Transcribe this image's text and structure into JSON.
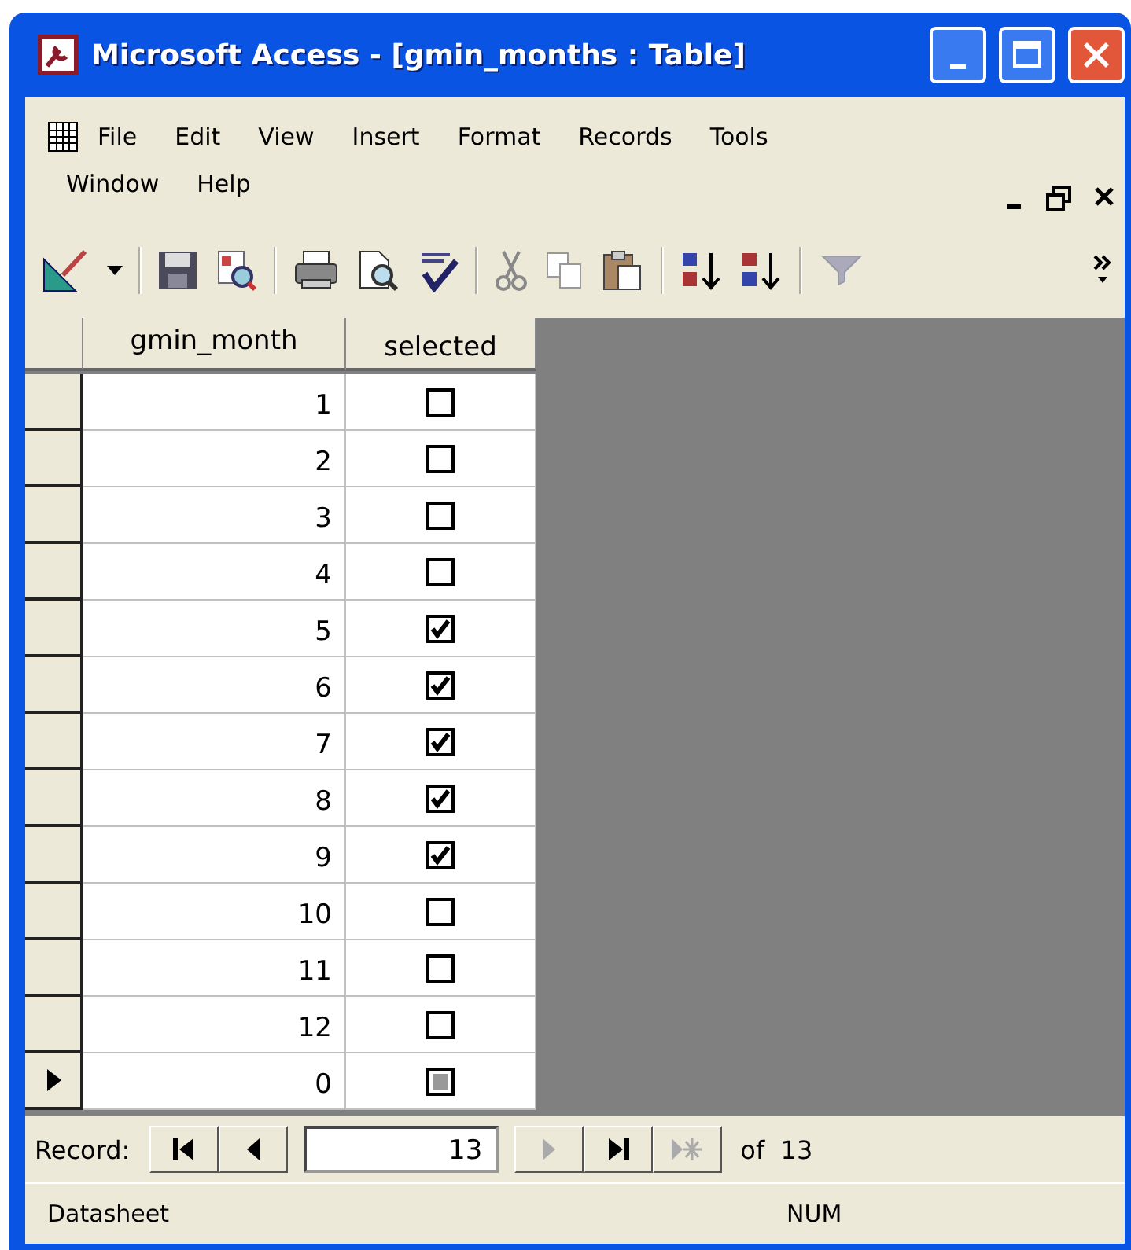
{
  "window": {
    "title": "Microsoft Access - [gmin_months : Table]"
  },
  "menu_bar": {
    "items": [
      {
        "label": "File"
      },
      {
        "label": "Edit"
      },
      {
        "label": "View"
      },
      {
        "label": "Insert"
      },
      {
        "label": "Format"
      },
      {
        "label": "Records"
      },
      {
        "label": "Tools"
      },
      {
        "label": "Window"
      },
      {
        "label": "Help"
      }
    ]
  },
  "datasheet": {
    "columns": [
      "gmin_month",
      "selected"
    ],
    "rows": [
      {
        "gmin_month": "1",
        "checked": false,
        "indeterminate": false,
        "current": false
      },
      {
        "gmin_month": "2",
        "checked": false,
        "indeterminate": false,
        "current": false
      },
      {
        "gmin_month": "3",
        "checked": false,
        "indeterminate": false,
        "current": false
      },
      {
        "gmin_month": "4",
        "checked": false,
        "indeterminate": false,
        "current": false
      },
      {
        "gmin_month": "5",
        "checked": true,
        "indeterminate": false,
        "current": false
      },
      {
        "gmin_month": "6",
        "checked": true,
        "indeterminate": false,
        "current": false
      },
      {
        "gmin_month": "7",
        "checked": true,
        "indeterminate": false,
        "current": false
      },
      {
        "gmin_month": "8",
        "checked": true,
        "indeterminate": false,
        "current": false
      },
      {
        "gmin_month": "9",
        "checked": true,
        "indeterminate": false,
        "current": false
      },
      {
        "gmin_month": "10",
        "checked": false,
        "indeterminate": false,
        "current": false
      },
      {
        "gmin_month": "11",
        "checked": false,
        "indeterminate": false,
        "current": false
      },
      {
        "gmin_month": "12",
        "checked": false,
        "indeterminate": false,
        "current": false
      },
      {
        "gmin_month": "0",
        "checked": false,
        "indeterminate": true,
        "current": true
      }
    ]
  },
  "record_navigator": {
    "label": "Record:",
    "current_record": "13",
    "total": "of  13",
    "buttons": [
      {
        "kind": "first",
        "disabled": false
      },
      {
        "kind": "previous",
        "disabled": false
      },
      {
        "kind": "next",
        "disabled": true
      },
      {
        "kind": "last",
        "disabled": false
      },
      {
        "kind": "new",
        "disabled": true
      }
    ]
  },
  "status_bar": {
    "mode": "Datasheet",
    "indicator": "NUM"
  }
}
